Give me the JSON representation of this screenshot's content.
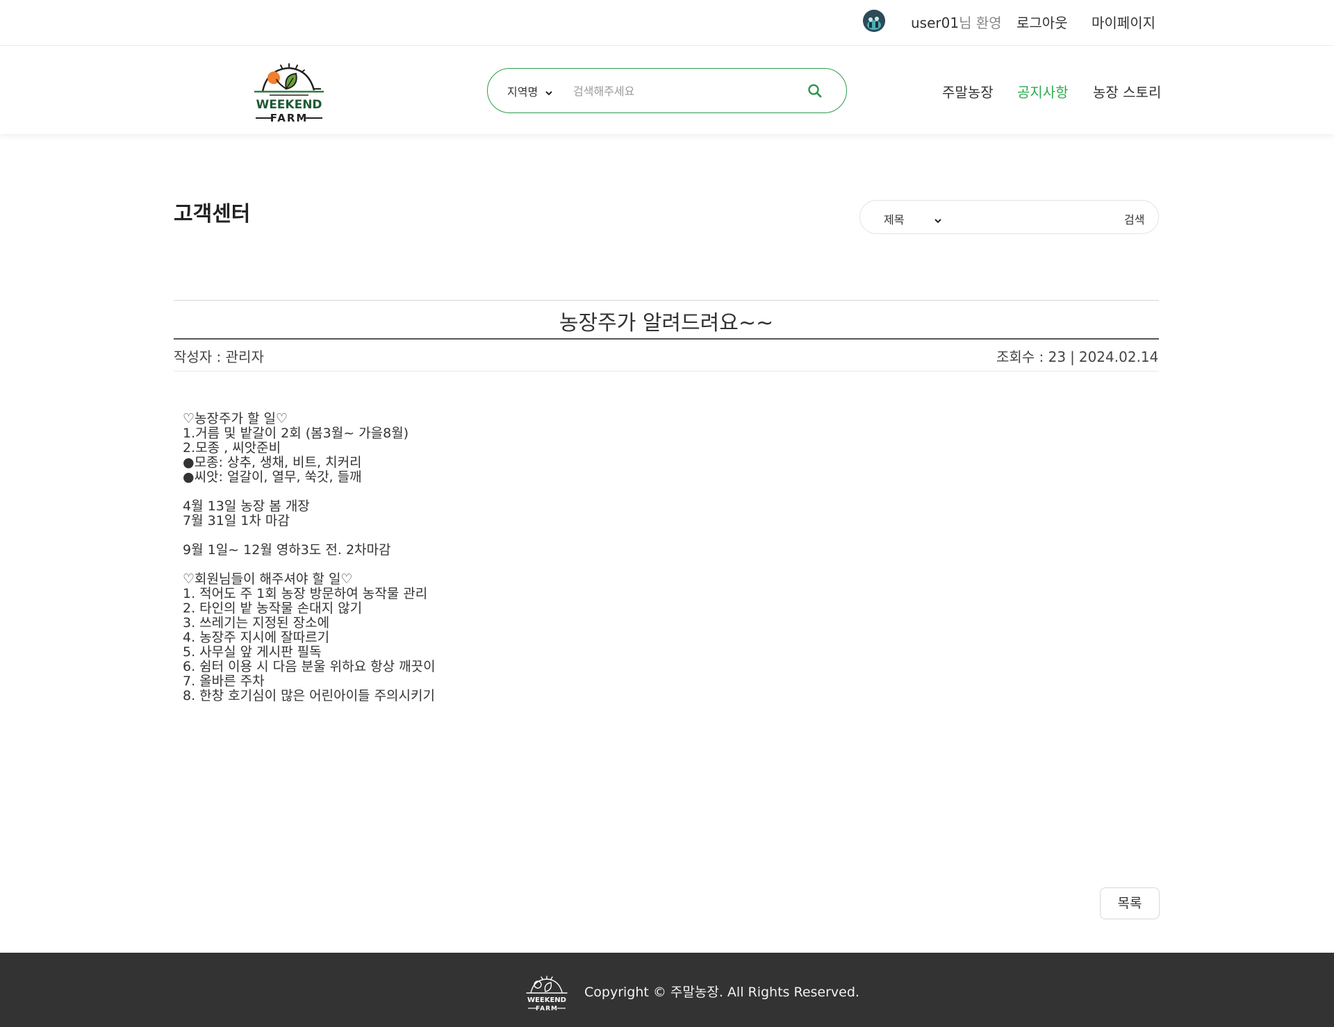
{
  "topbar": {
    "username": "user01",
    "welcome_suffix": "님 환영",
    "logout": "로그아웃",
    "mypage": "마이페이지"
  },
  "header": {
    "logo_text_1": "WEEKEND",
    "logo_text_2": "FARM",
    "region_select": "지역명",
    "search_placeholder": "검색해주세요",
    "nav": [
      "주말농장",
      "공지사항",
      "농장 스토리"
    ],
    "active_nav_color": "#2eac4f"
  },
  "page": {
    "title": "고객센터",
    "search_filter": "제목",
    "search_button": "검색"
  },
  "post": {
    "title": "농장주가 알려드려요~~",
    "author": "작성자 : 관리자",
    "views": "조회수 : 23",
    "separator": "|",
    "date": "2024.02.14",
    "body": [
      "♡농장주가 할 일♡",
      "1.거름 및 밭갈이 2회 (봄3월~ 가을8월)",
      "2.모종 , 씨앗준비",
      "●모종: 상추, 생채, 비트, 치커리",
      "●씨앗: 얼갈이, 열무, 쑥갓, 들깨",
      "",
      "4월 13일 농장 봄 개장",
      "7월 31일 1차 마감",
      "",
      "9월 1일~ 12월 영하3도 전. 2차마감",
      "",
      "♡회원님들이 해주셔야 할 일♡",
      "1. 적어도 주 1회 농장 방문하여 농작물 관리",
      "2. 타인의 밭 농작물 손대지 않기",
      "3. 쓰레기는 지정된 장소에",
      "4. 농장주 지시에 잘따르기",
      "5. 사무실 앞 게시판 필독",
      "6. 쉼터 이용 시 다음 분울 위하요 항상 깨끗이",
      "7. 올바른 주차",
      "8. 한창 호기심이 많은 어린아이들 주의시키기"
    ],
    "list_button": "목록"
  },
  "footer": {
    "copyright": "Copyright © 주말농장. All Rights Reserved."
  },
  "colors": {
    "brand_green": "#2e9a4c",
    "footer_bg": "#333333"
  }
}
